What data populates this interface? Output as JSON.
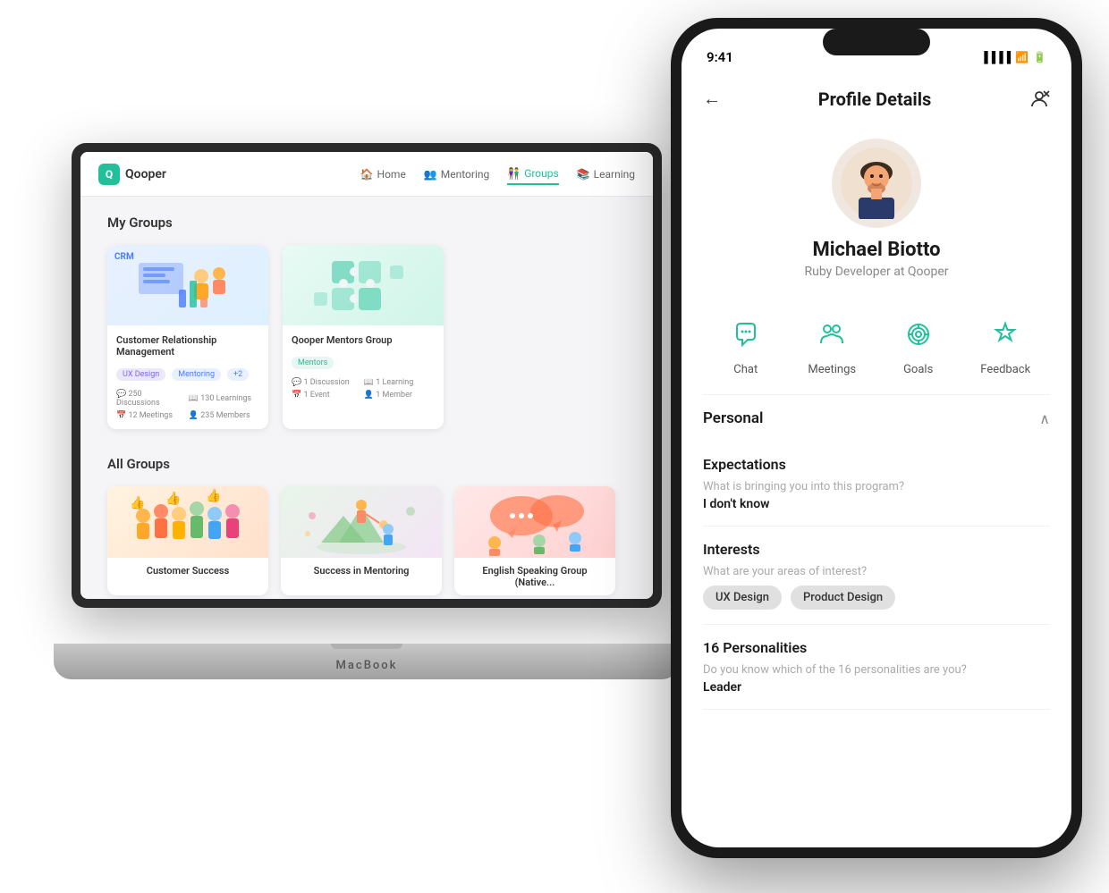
{
  "app": {
    "logo_letter": "Q",
    "logo_name": "Qooper",
    "nav": [
      {
        "label": "Home",
        "icon": "🏠",
        "active": false
      },
      {
        "label": "Mentoring",
        "icon": "👥",
        "active": false
      },
      {
        "label": "Groups",
        "icon": "👫",
        "active": true
      },
      {
        "label": "Learning",
        "icon": "📚",
        "active": false
      }
    ],
    "my_groups_title": "My Groups",
    "my_groups": [
      {
        "title": "Customer Relationship Management",
        "tags": [
          "UX Design",
          "Mentoring",
          "+2"
        ],
        "stats": [
          "250 Discussions",
          "130 Learnings",
          "12 Meetings",
          "235 Members"
        ]
      },
      {
        "title": "Qooper Mentors Group",
        "badge": "Mentors",
        "stats": [
          "1 Discussion",
          "1 Learning",
          "1 Event",
          "1 Member"
        ]
      }
    ],
    "all_groups_title": "All Groups",
    "all_groups": [
      {
        "title": "Customer Success"
      },
      {
        "title": "Success in Mentoring"
      },
      {
        "title": "English Speaking Group (Native..."
      }
    ]
  },
  "phone": {
    "status_time": "9:41",
    "back_label": "←",
    "page_title": "Profile Details",
    "action_icon": "person-x",
    "profile": {
      "name": "Michael Biotto",
      "role": "Ruby Developer at Qooper"
    },
    "actions": [
      {
        "label": "Chat",
        "icon": "chat"
      },
      {
        "label": "Meetings",
        "icon": "meetings"
      },
      {
        "label": "Goals",
        "icon": "goals"
      },
      {
        "label": "Feedback",
        "icon": "feedback"
      }
    ],
    "personal_title": "Personal",
    "sections": [
      {
        "title": "Expectations",
        "question": "What is bringing you into this program?",
        "answer": "I don't know",
        "type": "text"
      },
      {
        "title": "Interests",
        "question": "What are your areas of interest?",
        "tags": [
          "UX Design",
          "Product Design"
        ],
        "type": "tags"
      },
      {
        "title": "16 Personalities",
        "question": "Do you know which of the 16 personalities are you?",
        "answer": "Leader",
        "type": "text"
      }
    ]
  },
  "laptop_base": "MacBook"
}
